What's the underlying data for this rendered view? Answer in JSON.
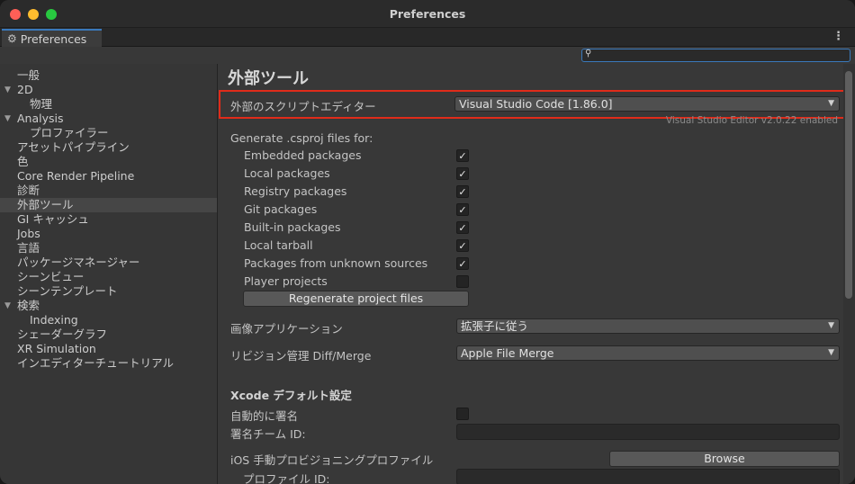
{
  "window": {
    "title": "Preferences"
  },
  "tab": {
    "label": "Preferences",
    "icon": "gear-icon"
  },
  "sidebar": {
    "items": [
      {
        "label": "一般",
        "indent": 0,
        "foldout": false,
        "selected": false
      },
      {
        "label": "2D",
        "indent": 0,
        "foldout": true,
        "selected": false
      },
      {
        "label": "物理",
        "indent": 1,
        "foldout": false,
        "selected": false
      },
      {
        "label": "Analysis",
        "indent": 0,
        "foldout": true,
        "selected": false
      },
      {
        "label": "プロファイラー",
        "indent": 1,
        "foldout": false,
        "selected": false
      },
      {
        "label": "アセットパイプライン",
        "indent": 0,
        "foldout": false,
        "selected": false
      },
      {
        "label": "色",
        "indent": 0,
        "foldout": false,
        "selected": false
      },
      {
        "label": "Core Render Pipeline",
        "indent": 0,
        "foldout": false,
        "selected": false
      },
      {
        "label": "診断",
        "indent": 0,
        "foldout": false,
        "selected": false
      },
      {
        "label": "外部ツール",
        "indent": 0,
        "foldout": false,
        "selected": true
      },
      {
        "label": "GI キャッシュ",
        "indent": 0,
        "foldout": false,
        "selected": false
      },
      {
        "label": "Jobs",
        "indent": 0,
        "foldout": false,
        "selected": false
      },
      {
        "label": "言語",
        "indent": 0,
        "foldout": false,
        "selected": false
      },
      {
        "label": "パッケージマネージャー",
        "indent": 0,
        "foldout": false,
        "selected": false
      },
      {
        "label": "シーンビュー",
        "indent": 0,
        "foldout": false,
        "selected": false
      },
      {
        "label": "シーンテンプレート",
        "indent": 0,
        "foldout": false,
        "selected": false
      },
      {
        "label": "検索",
        "indent": 0,
        "foldout": true,
        "selected": false
      },
      {
        "label": "Indexing",
        "indent": 1,
        "foldout": false,
        "selected": false
      },
      {
        "label": "シェーダーグラフ",
        "indent": 0,
        "foldout": false,
        "selected": false
      },
      {
        "label": "XR Simulation",
        "indent": 0,
        "foldout": false,
        "selected": false
      },
      {
        "label": "インエディターチュートリアル",
        "indent": 0,
        "foldout": false,
        "selected": false
      }
    ]
  },
  "main": {
    "heading": "外部ツール",
    "script_editor": {
      "label": "外部のスクリプトエディター",
      "value": "Visual Studio Code [1.86.0]"
    },
    "editor_note": "Visual Studio Editor v2.0.22 enabled",
    "csproj": {
      "label": "Generate .csproj files for:",
      "options": [
        {
          "label": "Embedded packages",
          "checked": true
        },
        {
          "label": "Local packages",
          "checked": true
        },
        {
          "label": "Registry packages",
          "checked": true
        },
        {
          "label": "Git packages",
          "checked": true
        },
        {
          "label": "Built-in packages",
          "checked": true
        },
        {
          "label": "Local tarball",
          "checked": true
        },
        {
          "label": "Packages from unknown sources",
          "checked": true
        },
        {
          "label": "Player projects",
          "checked": false
        }
      ],
      "regenerate_label": "Regenerate project files"
    },
    "image_app": {
      "label": "画像アプリケーション",
      "value": "拡張子に従う"
    },
    "revision": {
      "label": "リビジョン管理 Diff/Merge",
      "value": "Apple File Merge"
    },
    "xcode": {
      "heading": "Xcode デフォルト設定",
      "auto_sign_label": "自動的に署名",
      "auto_sign_checked": false,
      "team_id_label": "署名チーム ID:",
      "team_id_value": "",
      "ios_profile_label": "iOS 手動プロビジョニングプロファイル",
      "browse_label": "Browse",
      "profile_id_label": "プロファイル ID:",
      "profile_id_value": ""
    }
  },
  "colors": {
    "accent": "#3a79bb",
    "highlight": "#e02b1a",
    "selected_row": "#464646"
  }
}
